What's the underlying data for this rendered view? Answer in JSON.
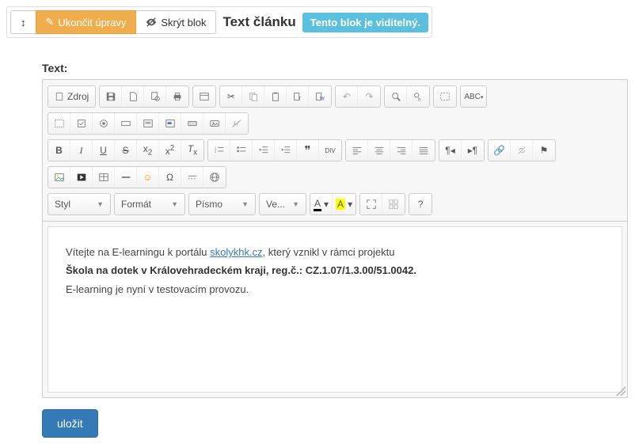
{
  "topbar": {
    "finish_edits": "Ukončit úpravy",
    "hide_block": "Skrýt blok",
    "title": "Text článku",
    "visible_badge": "Tento blok je viditelný."
  },
  "section_label": "Text:",
  "toolbar": {
    "source": "Zdroj",
    "style": "Styl",
    "format": "Formát",
    "font": "Písmo",
    "size": "Ve...",
    "textcolor": "A",
    "bgcolor": "A"
  },
  "content": {
    "p1_before": "Vítejte na E-learningu k portálu ",
    "p1_link": "skolykhk.cz",
    "p1_after": ", který vznikl v rámci projektu",
    "p2": "Škola na dotek v Královehradeckém kraji, reg.č.: CZ.1.07/1.3.00/51.0042.",
    "p3": "E-learning je nyní v testovacím provozu."
  },
  "save": "uložit"
}
